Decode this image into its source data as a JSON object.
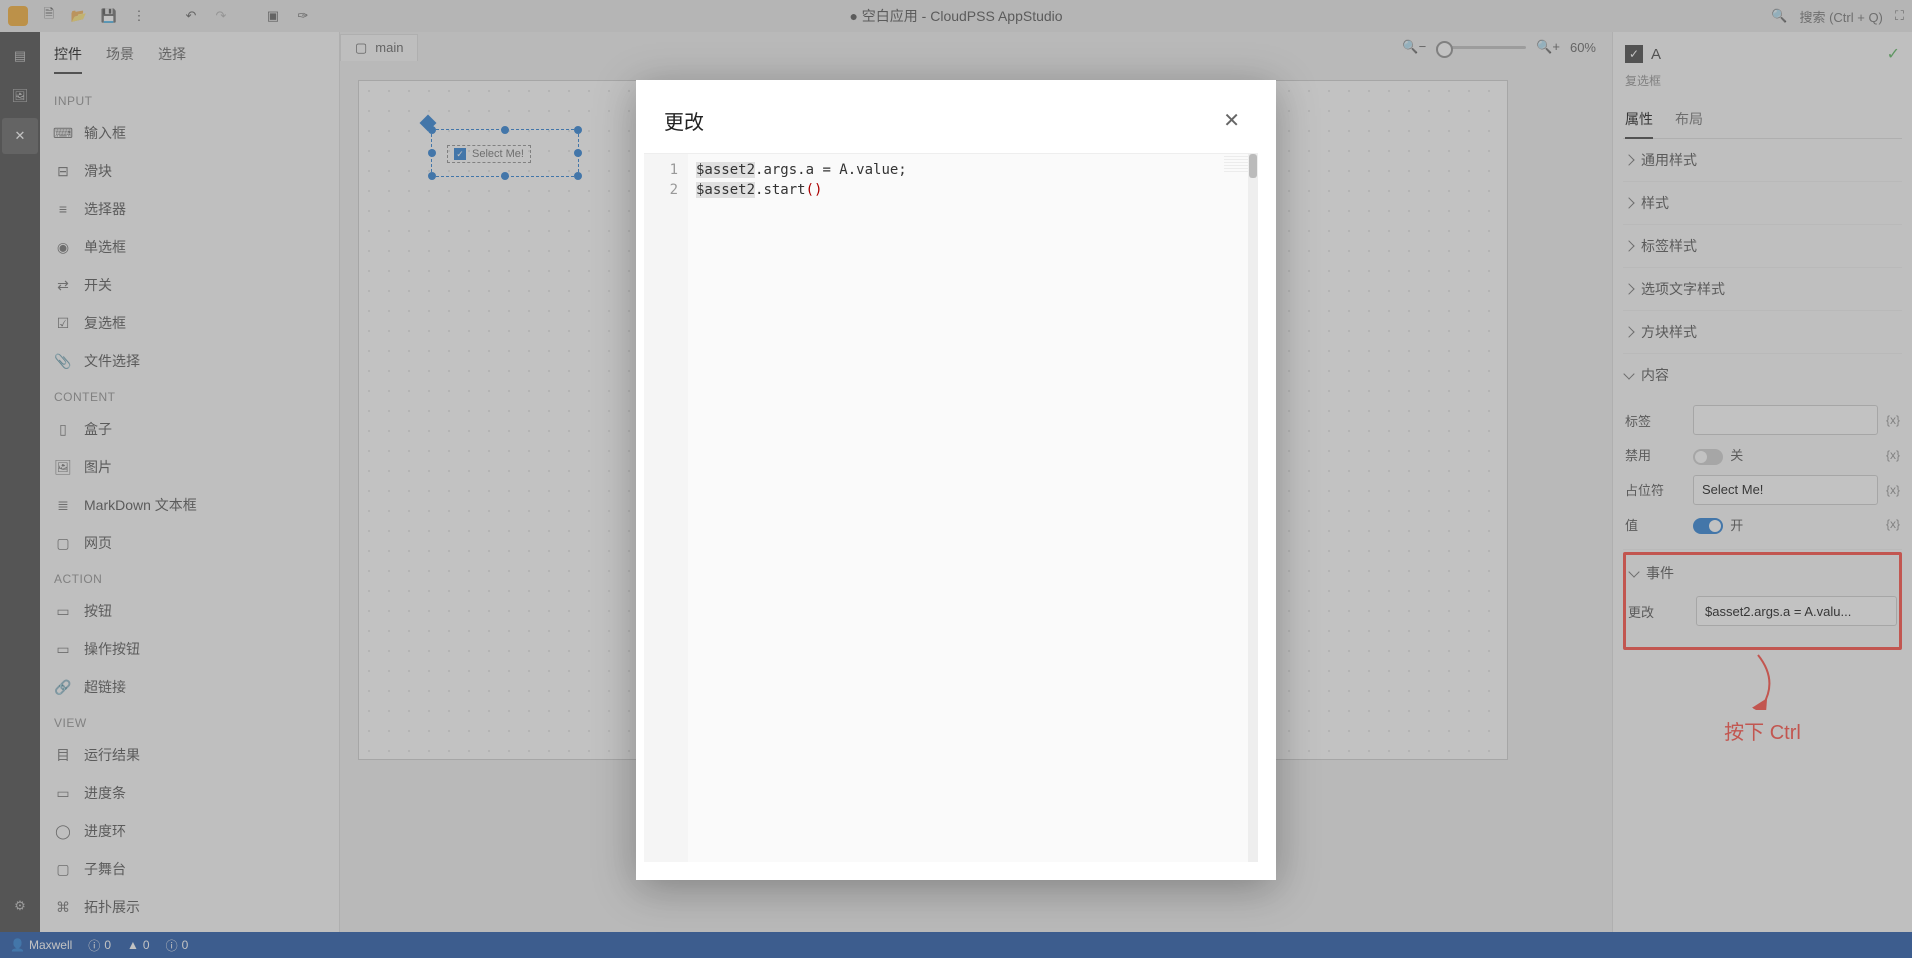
{
  "topbar": {
    "title": "● 空白应用 - CloudPSS AppStudio",
    "search_placeholder": "搜索 (Ctrl + Q)"
  },
  "leftpanel": {
    "tabs": {
      "controls": "控件",
      "scenes": "场景",
      "select": "选择"
    },
    "groups": {
      "input": {
        "title": "INPUT",
        "items": [
          "输入框",
          "滑块",
          "选择器",
          "单选框",
          "开关",
          "复选框",
          "文件选择"
        ]
      },
      "content": {
        "title": "CONTENT",
        "items": [
          "盒子",
          "图片",
          "MarkDown 文本框",
          "网页"
        ]
      },
      "action": {
        "title": "ACTION",
        "items": [
          "按钮",
          "操作按钮",
          "超链接"
        ]
      },
      "view": {
        "title": "VIEW",
        "items": [
          "运行结果",
          "进度条",
          "进度环",
          "子舞台",
          "拓扑展示"
        ]
      }
    }
  },
  "tabbar": {
    "main": "main",
    "zoom": "60%"
  },
  "canvas": {
    "selected_label": "Select Me!"
  },
  "rightpanel": {
    "component_name": "A",
    "component_type": "复选框",
    "tabs": {
      "props": "属性",
      "layout": "布局"
    },
    "sections": {
      "general_style": "通用样式",
      "style": "样式",
      "label_style": "标签样式",
      "option_text_style": "选项文字样式",
      "block_style": "方块样式",
      "content": "内容",
      "events": "事件"
    },
    "content": {
      "label_lbl": "标签",
      "label_val": "",
      "disabled_lbl": "禁用",
      "disabled_txt": "关",
      "placeholder_lbl": "占位符",
      "placeholder_val": "Select Me!",
      "value_lbl": "值",
      "value_txt": "开",
      "fx": "{x}"
    },
    "events": {
      "change_lbl": "更改",
      "change_val": "$asset2.args.a = A.valu..."
    }
  },
  "annotation": {
    "text": "按下 Ctrl"
  },
  "modal": {
    "title": "更改",
    "code_line1_a": "$asset2",
    "code_line1_b": ".args.a = A.value;",
    "code_line2_a": "$asset2",
    "code_line2_b": ".start",
    "code_line2_c": "()"
  },
  "statusbar": {
    "user": "Maxwell",
    "info": "0",
    "warn": "0",
    "err": "0"
  }
}
